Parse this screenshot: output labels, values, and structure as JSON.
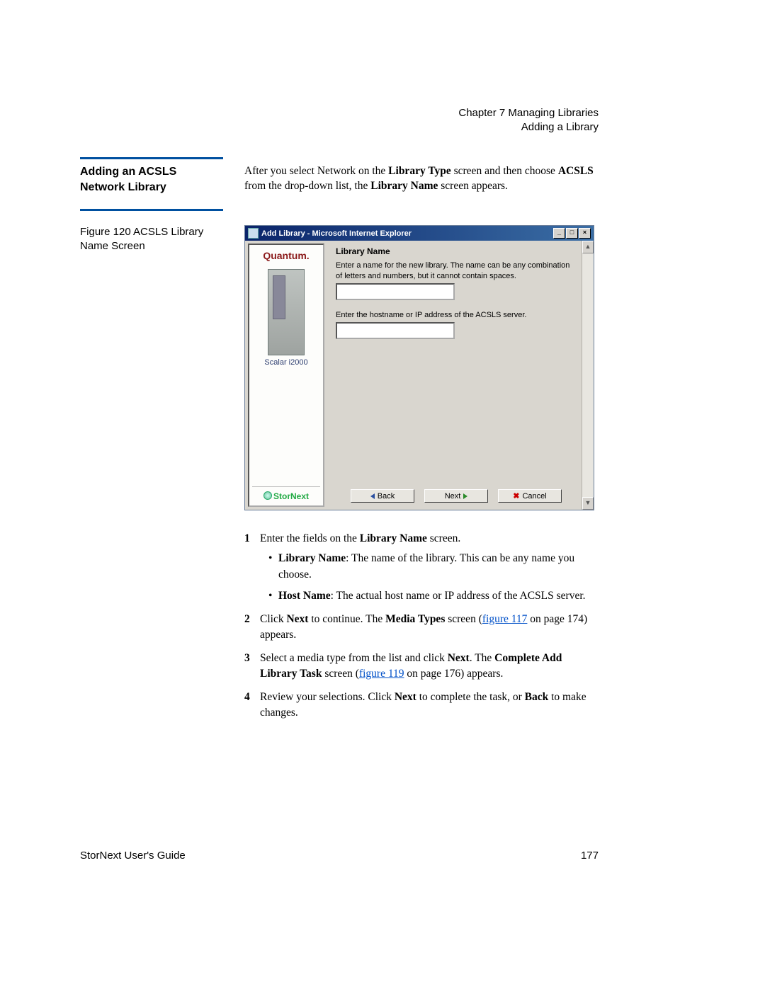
{
  "header": {
    "chapter": "Chapter 7  Managing Libraries",
    "section": "Adding a Library"
  },
  "section_heading": "Adding an ACSLS Network Library",
  "intro": {
    "prefix": "After you select Network on the ",
    "b1": "Library Type",
    "mid1": " screen and then choose ",
    "b2": "ACSLS",
    "mid2": " from the drop-down list, the ",
    "b3": "Library Name",
    "suffix": " screen appears."
  },
  "figure_caption": "Figure 120  ACSLS Library Name Screen",
  "dialog": {
    "title": "Add Library - Microsoft Internet Explorer",
    "minimize": "_",
    "maximize": "□",
    "close": "×",
    "scroll_up": "▲",
    "scroll_down": "▼",
    "sidebar": {
      "quantum": "Quantum.",
      "scalar": "Scalar i2000",
      "stornext": "StorNext"
    },
    "main": {
      "heading": "Library Name",
      "instr1": "Enter a name for the new library. The name can be any combination of letters and numbers, but it cannot contain spaces.",
      "instr2": "Enter the hostname or IP address of the ACSLS server."
    },
    "buttons": {
      "back": "Back",
      "next": "Next",
      "cancel": "Cancel"
    }
  },
  "steps": {
    "s1_a": "Enter the fields on the ",
    "s1_b": "Library Name",
    "s1_c": " screen.",
    "bul1_a": "Library Name",
    "bul1_b": ": The name of the library. This can be any name you choose.",
    "bul2_a": "Host Name",
    "bul2_b": ": The actual host name or IP address of the ACSLS server.",
    "s2_a": "Click ",
    "s2_b": "Next",
    "s2_c": " to continue. The ",
    "s2_d": "Media Types",
    "s2_e": " screen (",
    "s2_link": "figure 117",
    "s2_f": " on page 174) appears.",
    "s3_a": "Select a media type from the list and click ",
    "s3_b": "Next",
    "s3_c": ". The ",
    "s3_d": "Complete Add Library Task",
    "s3_e": " screen (",
    "s3_link": "figure 119",
    "s3_f": " on page 176) appears.",
    "s4_a": "Review your selections. Click ",
    "s4_b": "Next",
    "s4_c": " to complete the task, or ",
    "s4_d": "Back",
    "s4_e": " to make changes."
  },
  "footer": {
    "left": "StorNext User's Guide",
    "right": "177"
  }
}
